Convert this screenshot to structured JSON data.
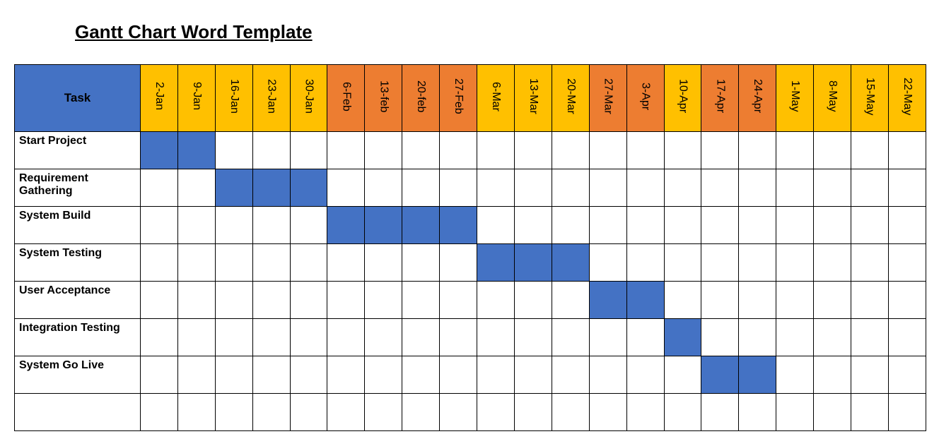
{
  "title": "Gantt Chart Word Template",
  "task_header": "Task",
  "colors": {
    "primary": "#4472c4",
    "header_amber": "#ffc000",
    "header_orange": "#ed7d31"
  },
  "dates": [
    {
      "label": "2-Jan",
      "scheme": "amber"
    },
    {
      "label": "9-Jan",
      "scheme": "amber"
    },
    {
      "label": "16-Jan",
      "scheme": "amber"
    },
    {
      "label": "23-Jan",
      "scheme": "amber"
    },
    {
      "label": "30-Jan",
      "scheme": "amber"
    },
    {
      "label": "6-Feb",
      "scheme": "orange"
    },
    {
      "label": "13-feb",
      "scheme": "orange"
    },
    {
      "label": "20-feb",
      "scheme": "orange"
    },
    {
      "label": "27-Feb",
      "scheme": "orange"
    },
    {
      "label": "6-Mar",
      "scheme": "amber"
    },
    {
      "label": "13-Mar",
      "scheme": "amber"
    },
    {
      "label": "20-Mar",
      "scheme": "amber"
    },
    {
      "label": "27-Mar",
      "scheme": "orange"
    },
    {
      "label": "3-Apr",
      "scheme": "orange"
    },
    {
      "label": "10-Apr",
      "scheme": "amber"
    },
    {
      "label": "17-Apr",
      "scheme": "orange"
    },
    {
      "label": "24-Apr",
      "scheme": "orange"
    },
    {
      "label": "1-May",
      "scheme": "amber"
    },
    {
      "label": "8-May",
      "scheme": "amber"
    },
    {
      "label": "15-May",
      "scheme": "amber"
    },
    {
      "label": "22-May",
      "scheme": "amber"
    }
  ],
  "tasks": [
    {
      "name": "Start Project",
      "start": 0,
      "span": 2
    },
    {
      "name": "Requirement Gathering",
      "start": 2,
      "span": 3
    },
    {
      "name": "System Build",
      "start": 5,
      "span": 4
    },
    {
      "name": "System Testing",
      "start": 9,
      "span": 3
    },
    {
      "name": "User Acceptance",
      "start": 12,
      "span": 2
    },
    {
      "name": "Integration Testing",
      "start": 14,
      "span": 1
    },
    {
      "name": "System Go Live",
      "start": 15,
      "span": 2
    },
    {
      "name": "",
      "start": -1,
      "span": 0
    }
  ],
  "chart_data": {
    "type": "gantt",
    "title": "Gantt Chart Word Template",
    "x_categories": [
      "2-Jan",
      "9-Jan",
      "16-Jan",
      "23-Jan",
      "30-Jan",
      "6-Feb",
      "13-feb",
      "20-feb",
      "27-Feb",
      "6-Mar",
      "13-Mar",
      "20-Mar",
      "27-Mar",
      "3-Apr",
      "10-Apr",
      "17-Apr",
      "24-Apr",
      "1-May",
      "8-May",
      "15-May",
      "22-May"
    ],
    "series": [
      {
        "name": "Start Project",
        "start_index": 0,
        "duration_weeks": 2
      },
      {
        "name": "Requirement Gathering",
        "start_index": 2,
        "duration_weeks": 3
      },
      {
        "name": "System Build",
        "start_index": 5,
        "duration_weeks": 4
      },
      {
        "name": "System Testing",
        "start_index": 9,
        "duration_weeks": 3
      },
      {
        "name": "User Acceptance",
        "start_index": 12,
        "duration_weeks": 2
      },
      {
        "name": "Integration Testing",
        "start_index": 14,
        "duration_weeks": 1
      },
      {
        "name": "System Go Live",
        "start_index": 15,
        "duration_weeks": 2
      }
    ]
  }
}
